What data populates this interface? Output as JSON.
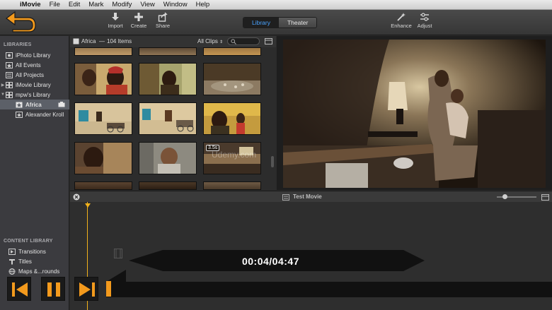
{
  "menubar": {
    "items": [
      "iMovie",
      "File",
      "Edit",
      "Mark",
      "Modify",
      "View",
      "Window",
      "Help"
    ]
  },
  "toolbar": {
    "import_label": "Import",
    "create_label": "Create",
    "share_label": "Share",
    "enhance_label": "Enhance",
    "adjust_label": "Adjust",
    "library_tab": "Library",
    "theater_tab": "Theater"
  },
  "sidebar": {
    "libraries_heading": "LIBRARIES",
    "items": [
      {
        "label": "iPhoto Library",
        "icon": "photo-library-icon"
      },
      {
        "label": "All Events",
        "icon": "events-icon"
      },
      {
        "label": "All Projects",
        "icon": "projects-icon"
      },
      {
        "label": "iMovie Library",
        "icon": "library-icon"
      },
      {
        "label": "mpw's Library",
        "icon": "library-icon"
      },
      {
        "label": "Africa",
        "icon": "star-event-icon"
      },
      {
        "label": "Alexander Kroll",
        "icon": "star-event-icon"
      }
    ],
    "content_heading": "CONTENT LIBRARY",
    "content_items": [
      {
        "label": "Transitions",
        "icon": "transitions-icon"
      },
      {
        "label": "Titles",
        "icon": "titles-icon"
      },
      {
        "label": "Maps &...rounds",
        "icon": "maps-icon"
      }
    ]
  },
  "browser": {
    "event_title": "Africa",
    "item_count": "104 Items",
    "filter_label": "All Clips",
    "duration_badge": "3.5s"
  },
  "timeline": {
    "project_title": "Test Movie"
  },
  "player": {
    "timecode": "00:04/04:47"
  },
  "watermark": "Udemy.com",
  "colors": {
    "accent": "#4aa3ff",
    "back_arrow": "#f39a1d",
    "controls": "#f39a1d",
    "playhead": "#f2b21b"
  }
}
